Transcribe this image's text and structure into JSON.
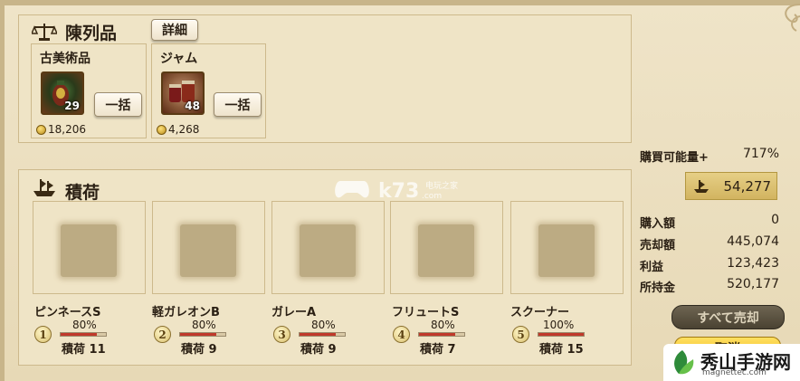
{
  "display": {
    "title": "陳列品",
    "detail_button": "詳細",
    "items": [
      {
        "name": "古美術品",
        "count": "29",
        "bulk_button": "一括",
        "price": "18,206"
      },
      {
        "name": "ジャム",
        "count": "48",
        "bulk_button": "一括",
        "price": "4,268"
      }
    ]
  },
  "cargo": {
    "title": "積荷",
    "ships": [
      {
        "name": "ピンネースS",
        "number": "1",
        "percent_label": "80%",
        "percent": 80,
        "cargo_label": "積荷 11"
      },
      {
        "name": "軽ガレオンB",
        "number": "2",
        "percent_label": "80%",
        "percent": 80,
        "cargo_label": "積荷 9"
      },
      {
        "name": "ガレーA",
        "number": "3",
        "percent_label": "80%",
        "percent": 80,
        "cargo_label": "積荷 9"
      },
      {
        "name": "フリュートS",
        "number": "4",
        "percent_label": "80%",
        "percent": 80,
        "cargo_label": "積荷 7"
      },
      {
        "name": "スクーナー",
        "number": "5",
        "percent_label": "100%",
        "percent": 100,
        "cargo_label": "積荷 15"
      }
    ]
  },
  "summary": {
    "capacity_label": "購買可能量+",
    "capacity_value": "717%",
    "money_icon": "ship-cargo-icon",
    "money_value": "54,277",
    "rows": [
      {
        "label": "購入額",
        "value": "0"
      },
      {
        "label": "売却額",
        "value": "445,074"
      },
      {
        "label": "利益",
        "value": "123,423"
      },
      {
        "label": "所持金",
        "value": "520,177"
      }
    ],
    "sell_all_button": "すべて売却",
    "cancel_button": "取消"
  },
  "watermark": {
    "k73_text": "k73",
    "k73_sub": "电玩之家",
    "k73_url": ".com",
    "logo_text": "秀山手游网",
    "logo_sub": "magnettec.com"
  },
  "colors": {
    "background": "#e9dcbd",
    "bar_fill": "#c0392b",
    "money_box": "#d9be6c",
    "dark_button": "#5a5242",
    "cancel_button": "#f5c830"
  }
}
